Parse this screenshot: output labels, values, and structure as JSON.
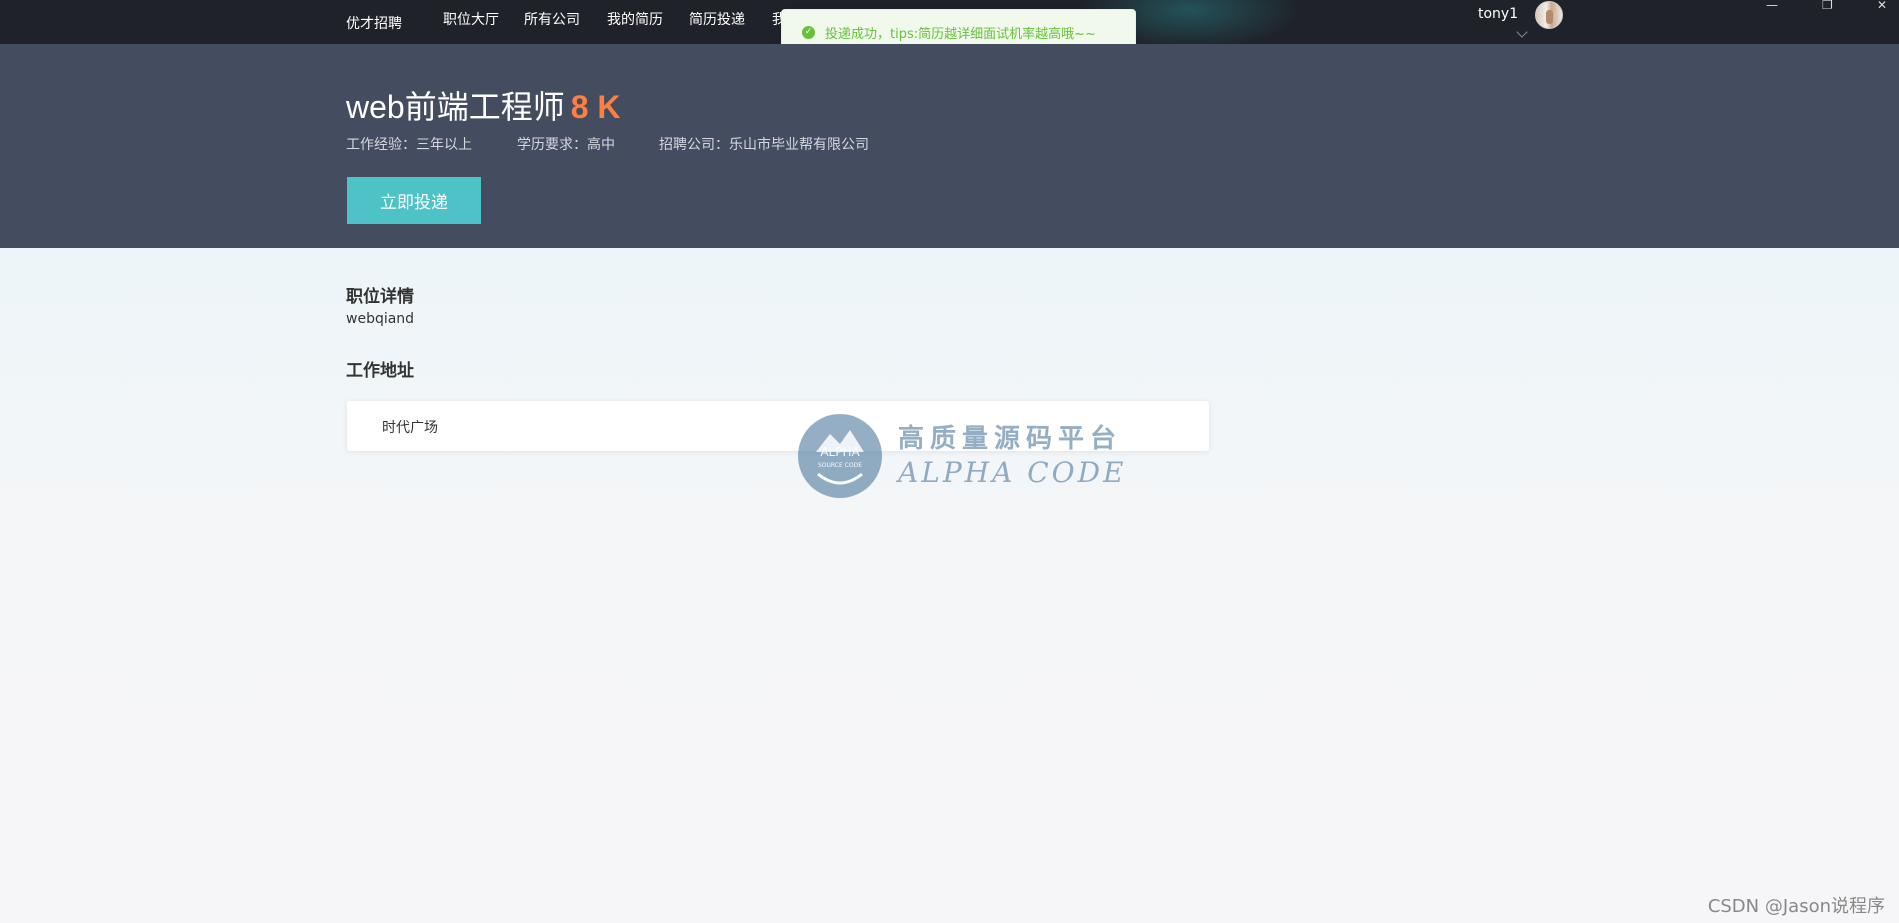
{
  "navbar": {
    "brand": "优才招聘",
    "items": [
      {
        "label": "职位大厅"
      },
      {
        "label": "所有公司"
      },
      {
        "label": "我的简历"
      },
      {
        "label": "简历投递"
      },
      {
        "label": "我"
      }
    ],
    "user_name": "tony1",
    "window_controls": [
      "—",
      "❐",
      "✕"
    ]
  },
  "toast": {
    "icon": "check-circle-icon",
    "message": "投递成功，tips:简历越详细面试机率越高哦~~",
    "color": "#67c23a"
  },
  "job": {
    "title": "web前端工程师",
    "salary": "8 K",
    "experience": "工作经验：三年以上",
    "education": "学历要求：高中",
    "company": "招聘公司：乐山市毕业帮有限公司",
    "apply_label": "立即投递"
  },
  "detail": {
    "section_title": "职位详情",
    "description": "webqiand"
  },
  "address": {
    "section_title": "工作地址",
    "location": "时代广场"
  },
  "watermark": {
    "logo_text": "ALPHA",
    "logo_subtext": "SOURCE CODE",
    "cn_text": "高质量源码平台",
    "en_text": "ALPHA CODE"
  },
  "footer": {
    "credit": "CSDN @Jason说程序"
  },
  "colors": {
    "navbar_bg": "#1f2329",
    "band_bg": "#444c5f",
    "accent_salary": "#fd7f42",
    "apply_button": "#4ec3c7"
  }
}
